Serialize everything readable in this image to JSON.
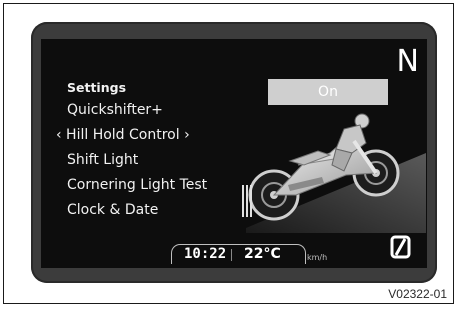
{
  "screen": {
    "gear_indicator": "N",
    "menu": {
      "title": "Settings",
      "items": [
        {
          "label": "Quickshifter+"
        },
        {
          "label": "‹ Hill Hold Control ›",
          "selected": true
        },
        {
          "label": "Shift Light"
        },
        {
          "label": "Cornering Light Test"
        },
        {
          "label": "Clock & Date"
        }
      ]
    },
    "value_button": "On",
    "status_bar": {
      "time": "10:22",
      "temperature": "22°C",
      "speed_unit": "km/h"
    },
    "icons": {
      "bike": "motorcycle-icon",
      "speed_bars": "speed-bars-icon",
      "null_icon": "slashed-zero-icon"
    }
  },
  "caption": "V02322-01"
}
